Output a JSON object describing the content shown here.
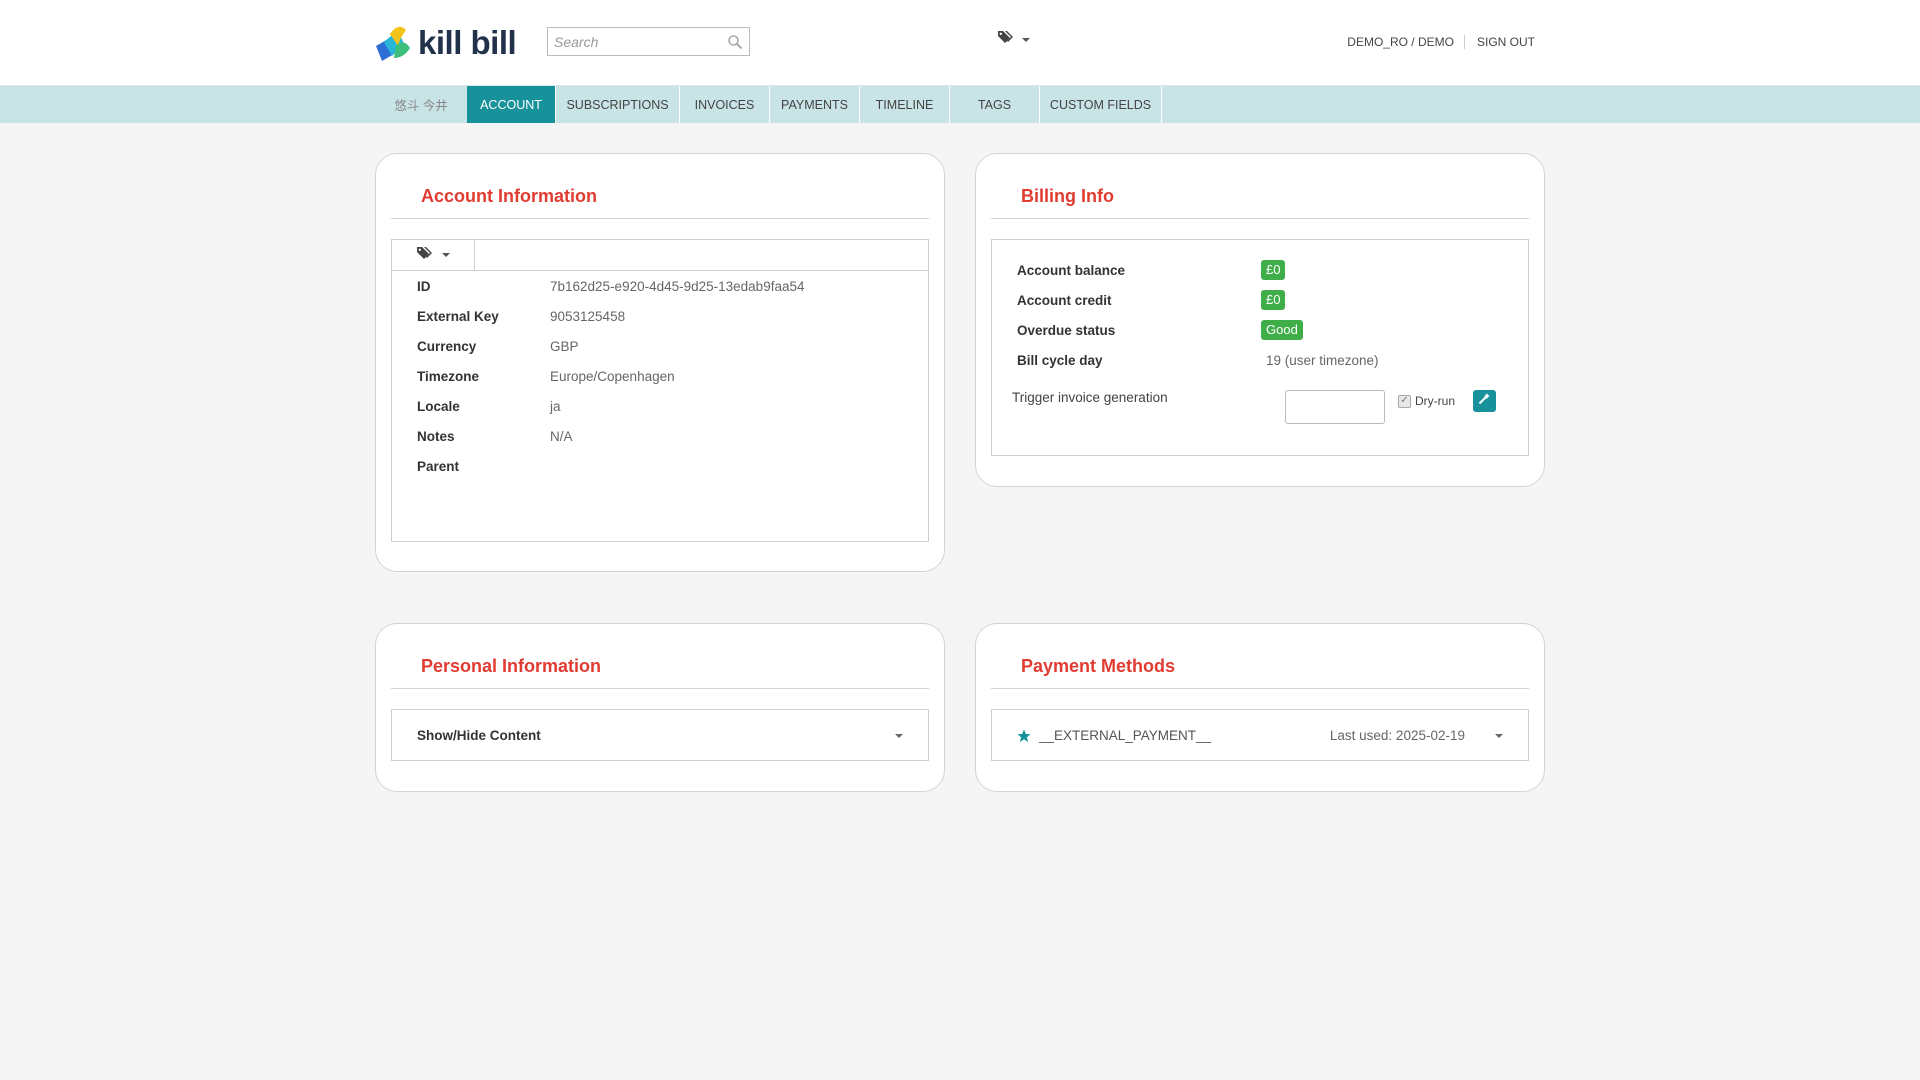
{
  "header": {
    "logo_text": "kill bill",
    "search_placeholder": "Search",
    "user": "DEMO_RO / DEMO",
    "sign_out": "SIGN OUT"
  },
  "nav": {
    "items": [
      {
        "label": "悠斗 今井",
        "active": false
      },
      {
        "label": "ACCOUNT",
        "active": true
      },
      {
        "label": "SUBSCRIPTIONS",
        "active": false
      },
      {
        "label": "INVOICES",
        "active": false
      },
      {
        "label": "PAYMENTS",
        "active": false
      },
      {
        "label": "TIMELINE",
        "active": false
      },
      {
        "label": "TAGS",
        "active": false
      },
      {
        "label": "CUSTOM FIELDS",
        "active": false
      }
    ]
  },
  "account_info": {
    "title": "Account Information",
    "fields": [
      {
        "key": "ID",
        "value": "7b162d25-e920-4d45-9d25-13edab9faa54"
      },
      {
        "key": "External Key",
        "value": "9053125458"
      },
      {
        "key": "Currency",
        "value": "GBP"
      },
      {
        "key": "Timezone",
        "value": "Europe/Copenhagen"
      },
      {
        "key": "Locale",
        "value": "ja"
      },
      {
        "key": "Notes",
        "value": "N/A"
      },
      {
        "key": "Parent",
        "value": ""
      }
    ]
  },
  "billing_info": {
    "title": "Billing Info",
    "account_balance_label": "Account balance",
    "account_balance": "£0",
    "account_credit_label": "Account credit",
    "account_credit": "£0",
    "overdue_status_label": "Overdue status",
    "overdue_status": "Good",
    "bill_cycle_day_label": "Bill cycle day",
    "bill_cycle_day": "19 (user timezone)",
    "trigger_label": "Trigger invoice generation",
    "trigger_value": "",
    "dry_run_label": "Dry-run",
    "dry_run_checked": true
  },
  "personal_info": {
    "title": "Personal Information",
    "toggle_label": "Show/Hide Content"
  },
  "payment_methods": {
    "title": "Payment Methods",
    "method_name": "__EXTERNAL_PAYMENT__",
    "last_used": "Last used: 2025-02-19"
  },
  "colors": {
    "accent": "#17919a",
    "title_red": "#e03c31",
    "badge_green": "#3fae49",
    "nav_bg": "#c9e4e7"
  }
}
